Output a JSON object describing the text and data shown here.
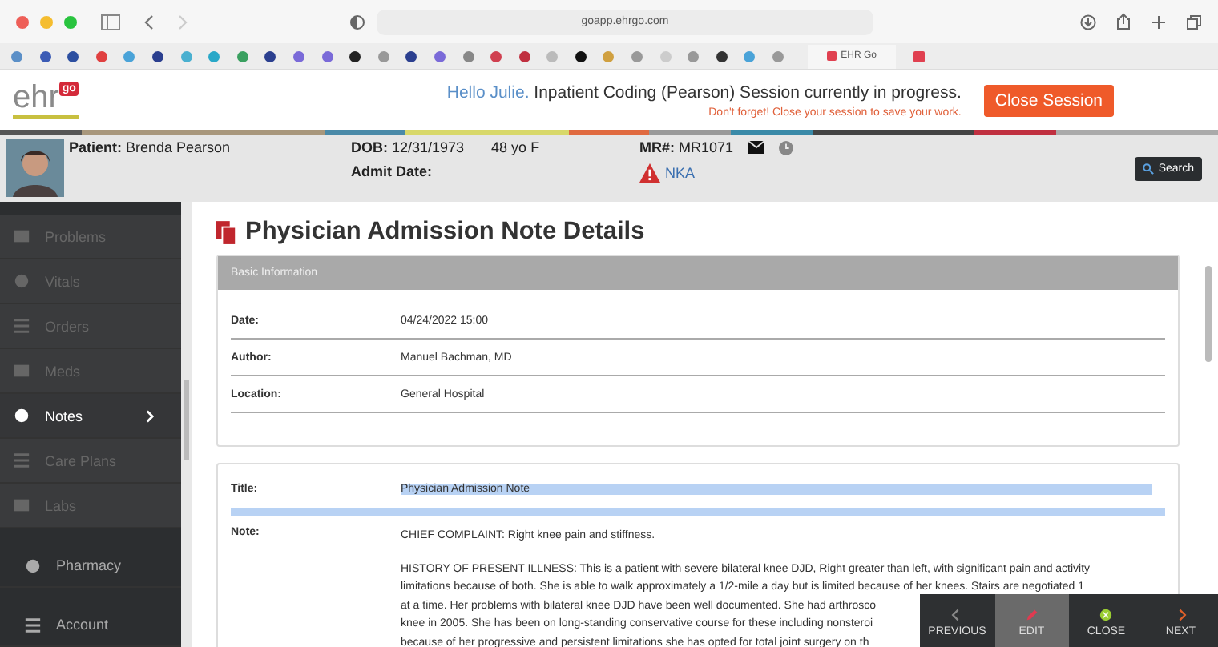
{
  "browser": {
    "url": "goapp.ehrgo.com",
    "tab": "EHR Go"
  },
  "header": {
    "logo": "ehr",
    "logo_badge": "go",
    "greeting": "Hello Julie.",
    "session": "Inpatient Coding (Pearson) Session currently in progress.",
    "reminder": "Don't forget! Close your session to save your work.",
    "close_button": "Close Session"
  },
  "patient": {
    "patient_label": "Patient:",
    "name": "Brenda Pearson",
    "dob_label": "DOB:",
    "dob": "12/31/1973",
    "age": "48 yo F",
    "admit_label": "Admit Date:",
    "mr_label": "MR#:",
    "mr": "MR1071",
    "allergy": "NKA",
    "search": "Search"
  },
  "sidebar": [
    {
      "label": "Problems",
      "kind": "sub",
      "selected": false
    },
    {
      "label": "Vitals",
      "kind": "sub",
      "selected": false
    },
    {
      "label": "Orders",
      "kind": "sub",
      "selected": false
    },
    {
      "label": "Meds",
      "kind": "sub",
      "selected": false
    },
    {
      "label": "Notes",
      "kind": "sub",
      "selected": true
    },
    {
      "label": "Care Plans",
      "kind": "sub",
      "selected": false
    },
    {
      "label": "Labs",
      "kind": "sub",
      "selected": false
    },
    {
      "label": "Pharmacy",
      "kind": "main",
      "selected": false
    },
    {
      "label": "Account",
      "kind": "main",
      "selected": false
    }
  ],
  "page_title": "Physician Admission Note Details",
  "basic": {
    "header": "Basic Information",
    "rows": [
      {
        "label": "Date:",
        "value": "04/24/2022 15:00"
      },
      {
        "label": "Author:",
        "value": "Manuel Bachman, MD"
      },
      {
        "label": "Location:",
        "value": "General Hospital"
      }
    ]
  },
  "note": {
    "title_label": "Title:",
    "title": "Physician Admission Note",
    "title_selected": true,
    "note_label": "Note:",
    "chief": "CHIEF COMPLAINT: Right knee pain and stiffness.",
    "lines": [
      "HISTORY OF PRESENT ILLNESS: This is a patient with severe bilateral knee DJD, Right greater than left, with significant pain and activity",
      "limitations because of both. She is able to walk approximately a 1/2-mile a day but is limited because of her knees. Stairs are negotiated 1",
      "at a time. Her problems with bilateral knee DJD have been well documented. She had arthrosco",
      "knee in 2005. She has been on long-standing conservative course for these including nonsteroi",
      "because of her progressive and persistent limitations she has opted for total joint surgery on th"
    ]
  },
  "toolbar": [
    {
      "label": "PREVIOUS",
      "kind": "previous",
      "selected": false
    },
    {
      "label": "EDIT",
      "kind": "edit",
      "selected": true
    },
    {
      "label": "CLOSE",
      "kind": "close",
      "selected": false
    },
    {
      "label": "NEXT",
      "kind": "next",
      "selected": false
    }
  ]
}
